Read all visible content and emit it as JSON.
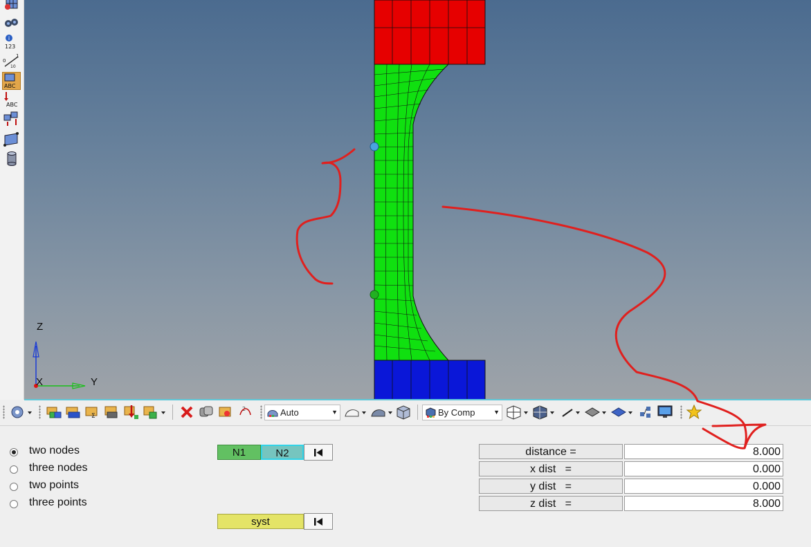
{
  "viewport": {
    "axis_labels": {
      "z": "Z",
      "x": "X",
      "y": "Y"
    },
    "colors": {
      "top_component": "#e60000",
      "middle_component": "#10e010",
      "bottom_component": "#0a17d8",
      "node_1": "#4aa3df",
      "node_2": "#22b022",
      "annotation": "#e0201e"
    }
  },
  "left_toolbar": {
    "icons": [
      "mesh-view-icon",
      "binoculars-icon",
      "info-123-icon",
      "measure-axis-icon",
      "label-abc-icon",
      "arrow-abc-icon",
      "transform-icon",
      "plane-icon",
      "cylinder-icon"
    ],
    "labels": {
      "info": "123",
      "abc": "ABC",
      "abc2": "ABC",
      "axis_start": "0",
      "axis_end": "1",
      "axis_mid": "10"
    }
  },
  "toolbar": {
    "visualization_mode": "Auto",
    "color_mode": "By Comp",
    "spinner_label": "2"
  },
  "measure_panel": {
    "options": [
      {
        "label": "two nodes",
        "selected": true
      },
      {
        "label": "three nodes",
        "selected": false
      },
      {
        "label": "two points",
        "selected": false
      },
      {
        "label": "three points",
        "selected": false
      }
    ],
    "node_buttons": {
      "n1": "N1",
      "n2": "N2"
    },
    "system_button": "syst",
    "fields": [
      {
        "label": "distance =",
        "value": "8.000"
      },
      {
        "label": "x dist   =",
        "value": "0.000"
      },
      {
        "label": "y dist   =",
        "value": "0.000"
      },
      {
        "label": "z dist   =",
        "value": "8.000"
      }
    ]
  }
}
